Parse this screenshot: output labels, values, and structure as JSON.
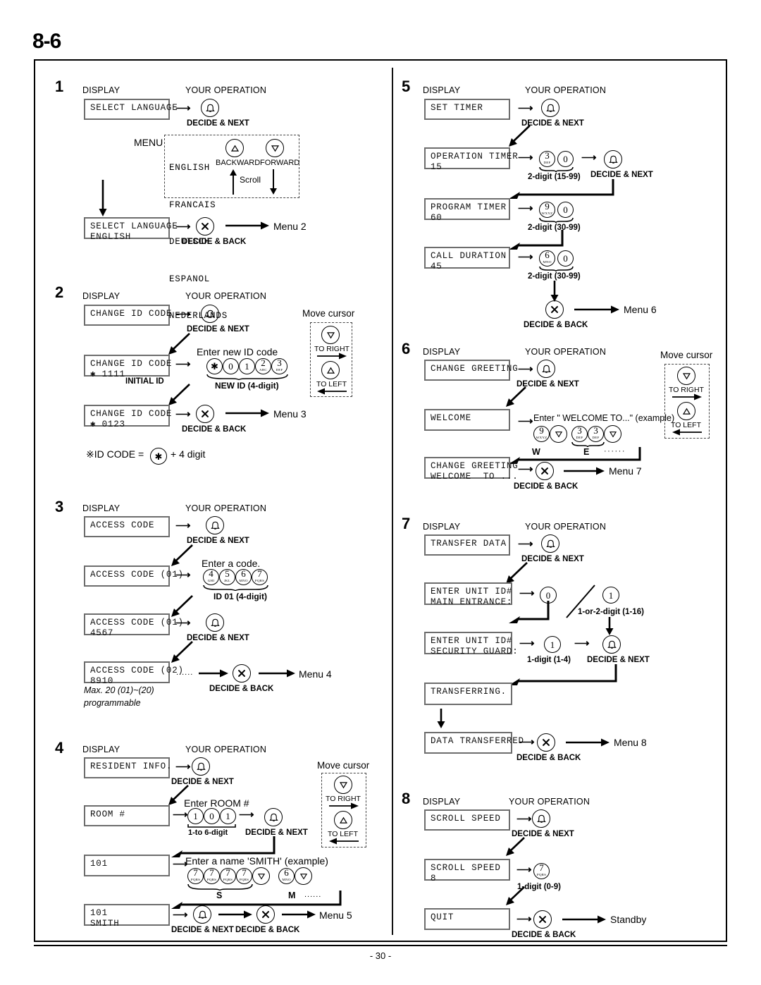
{
  "header": {
    "chapter": "8-6"
  },
  "footer": {
    "page_number": "- 30 -"
  },
  "column_headers": {
    "display": "DISPLAY",
    "operation": "YOUR OPERATION"
  },
  "buttons": {
    "decide_next": "DECIDE & NEXT",
    "decide_back": "DECIDE & BACK",
    "backward": "BACKWARD",
    "forward": "FORWARD",
    "to_right": "TO RIGHT",
    "to_left": "TO LEFT",
    "scroll": "Scroll",
    "move_cursor": "Move cursor"
  },
  "sections": [
    {
      "number": "1",
      "displays": [
        {
          "line1": "SELECT LANGUAGE",
          "line2": ""
        },
        {
          "line1": "SELECT LANGUAGE",
          "line2": "ENGLISH"
        }
      ],
      "menu_label": "MENU",
      "menu_options": [
        "ENGLISH",
        "FRANCAIS",
        "DEUTSCH",
        "ESPANOL",
        "NEDERLANDS"
      ],
      "next_menu": "Menu 2"
    },
    {
      "number": "2",
      "displays": [
        {
          "line1": "CHANGE ID CODE",
          "line2": ""
        },
        {
          "line1": "CHANGE ID CODE",
          "line2": "✱ 1111"
        },
        {
          "line1": "CHANGE ID CODE",
          "line2": "✱ 0123"
        }
      ],
      "initial_id_label": "INITIAL ID",
      "prompt": "Enter new ID code",
      "keys": [
        "✱",
        "0",
        "1",
        "2",
        "3"
      ],
      "key_subs": [
        "",
        "",
        "",
        "ABC",
        "DEF"
      ],
      "key_caption": "NEW ID (4-digit)",
      "note": "※ID CODE =",
      "note_suffix": "+ 4 digit",
      "next_menu": "Menu 3"
    },
    {
      "number": "3",
      "displays": [
        {
          "line1": "ACCESS CODE",
          "line2": ""
        },
        {
          "line1": "ACCESS CODE (01)",
          "line2": ""
        },
        {
          "line1": "ACCESS CODE (01)",
          "line2": "4567"
        },
        {
          "line1": "ACCESS CODE (02)",
          "line2": "8910"
        }
      ],
      "prompt": "Enter a code.",
      "keys": [
        "4",
        "5",
        "6",
        "7"
      ],
      "key_subs": [
        "GHI",
        "JKL",
        "MNO",
        "PQRS"
      ],
      "key_caption": "ID 01 (4-digit)",
      "footnote_line1": "Max. 20 (01)~(20)",
      "footnote_line2": "programmable",
      "ellipsis": "......",
      "next_menu": "Menu 4"
    },
    {
      "number": "4",
      "displays": [
        {
          "line1": "RESIDENT INFO.",
          "line2": ""
        },
        {
          "line1": "ROOM #",
          "line2": ""
        },
        {
          "line1": "101",
          "line2": ""
        },
        {
          "line1": "101",
          "line2": "SMITH"
        }
      ],
      "prompt_room": "Enter ROOM #",
      "room_keys": [
        "1",
        "0",
        "1"
      ],
      "room_caption": "1-to 6-digit",
      "prompt_name": "Enter a name 'SMITH' (example)",
      "name_keys": [
        "7",
        "7",
        "7",
        "7",
        "▽",
        "6",
        "▽"
      ],
      "letter_s": "S",
      "letter_m": "M",
      "ellipsis": "......",
      "next_menu": "Menu 5"
    },
    {
      "number": "5",
      "displays": [
        {
          "line1": "SET TIMER",
          "line2": ""
        },
        {
          "line1": "OPERATION TIMER",
          "line2": "15"
        },
        {
          "line1": "PROGRAM TIMER",
          "line2": "60"
        },
        {
          "line1": "CALL DURATION",
          "line2": "45"
        }
      ],
      "rows": [
        {
          "keys": [
            "3",
            "0"
          ],
          "subs": [
            "DEF",
            ""
          ],
          "caption": "2-digit (15-99)"
        },
        {
          "keys": [
            "9",
            "0"
          ],
          "subs": [
            "WXYZ",
            ""
          ],
          "caption": "2-digit (30-99)"
        },
        {
          "keys": [
            "6",
            "0"
          ],
          "subs": [
            "MNO",
            ""
          ],
          "caption": "2-digit (30-99)"
        }
      ],
      "next_menu": "Menu 6"
    },
    {
      "number": "6",
      "displays": [
        {
          "line1": "CHANGE GREETING",
          "line2": ""
        },
        {
          "line1": "WELCOME",
          "line2": ""
        },
        {
          "line1": "CHANGE GREETING",
          "line2": "WELCOME  TO ..."
        }
      ],
      "prompt": "Enter \" WELCOME TO...\" (example)",
      "keys": [
        "9",
        "▽",
        "3",
        "3",
        "▽"
      ],
      "key_subs": [
        "WXYZ",
        "",
        "DEF",
        "DEF",
        ""
      ],
      "letter_w": "W",
      "letter_e": "E",
      "ellipsis": "······",
      "next_menu": "Menu 7"
    },
    {
      "number": "7",
      "displays": [
        {
          "line1": "TRANSFER DATA",
          "line2": ""
        },
        {
          "line1": "ENTER UNIT ID#",
          "line2": "MAIN ENTRANCE:"
        },
        {
          "line1": "ENTER UNIT ID#",
          "line2": "SECURITY GUARD:"
        },
        {
          "line1": "TRANSFERRING.",
          "line2": ""
        },
        {
          "line1": "DATA TRANSFERRED",
          "line2": ""
        }
      ],
      "key_zero": "0",
      "key_one_a": "1",
      "caption_unit": "1-or-2-digit (1-16)",
      "key_one_b": "1",
      "caption_guard": "1-digit (1-4)",
      "next_menu": "Menu 8"
    },
    {
      "number": "8",
      "displays": [
        {
          "line1": "SCROLL SPEED",
          "line2": ""
        },
        {
          "line1": "SCROLL SPEED",
          "line2": "8"
        },
        {
          "line1": "QUIT",
          "line2": ""
        }
      ],
      "key": "7",
      "key_sub": "PQRS",
      "caption": "1-digit (0-9)",
      "next_menu": "Standby"
    }
  ]
}
